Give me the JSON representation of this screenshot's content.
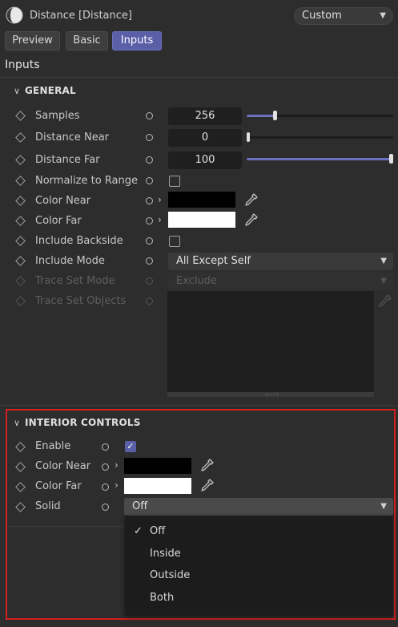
{
  "header": {
    "title": "Distance [Distance]",
    "preset": "Custom",
    "tabs": [
      {
        "label": "Preview",
        "active": false
      },
      {
        "label": "Basic",
        "active": false
      },
      {
        "label": "Inputs",
        "active": true
      }
    ]
  },
  "section_title": "Inputs",
  "general": {
    "title": "GENERAL",
    "samples": {
      "label": "Samples",
      "value": "256",
      "slider_fraction": 0.19
    },
    "distance_near": {
      "label": "Distance Near",
      "value": "0",
      "slider_fraction": 0.0
    },
    "distance_far": {
      "label": "Distance Far",
      "value": "100",
      "slider_fraction": 1.0
    },
    "normalize": {
      "label": "Normalize to Range",
      "checked": false
    },
    "color_near": {
      "label": "Color Near",
      "color": "#000000"
    },
    "color_far": {
      "label": "Color Far",
      "color": "#ffffff"
    },
    "include_backside": {
      "label": "Include Backside",
      "checked": false
    },
    "include_mode": {
      "label": "Include Mode",
      "value": "All Except Self"
    },
    "trace_set_mode": {
      "label": "Trace Set Mode",
      "value": "Exclude",
      "disabled": true
    },
    "trace_set_objects": {
      "label": "Trace Set Objects",
      "disabled": true
    }
  },
  "interior": {
    "title": "INTERIOR CONTROLS",
    "enable": {
      "label": "Enable",
      "checked": true,
      "check_glyph": "✓"
    },
    "color_near": {
      "label": "Color Near",
      "color": "#000000"
    },
    "color_far": {
      "label": "Color Far",
      "color": "#ffffff"
    },
    "solid": {
      "label": "Solid",
      "value": "Off",
      "options": [
        {
          "label": "Off",
          "selected": true
        },
        {
          "label": "Inside",
          "selected": false
        },
        {
          "label": "Outside",
          "selected": false
        },
        {
          "label": "Both",
          "selected": false
        }
      ]
    }
  },
  "icons": {
    "chevron": "chevron-down-icon",
    "keyframe": "diamond-icon",
    "animate": "circle-icon",
    "expand": "chevron-right-icon",
    "picker": "eyedropper-icon"
  },
  "colors": {
    "accent": "#5a5fa8",
    "highlight_box": "#d31f1f"
  }
}
